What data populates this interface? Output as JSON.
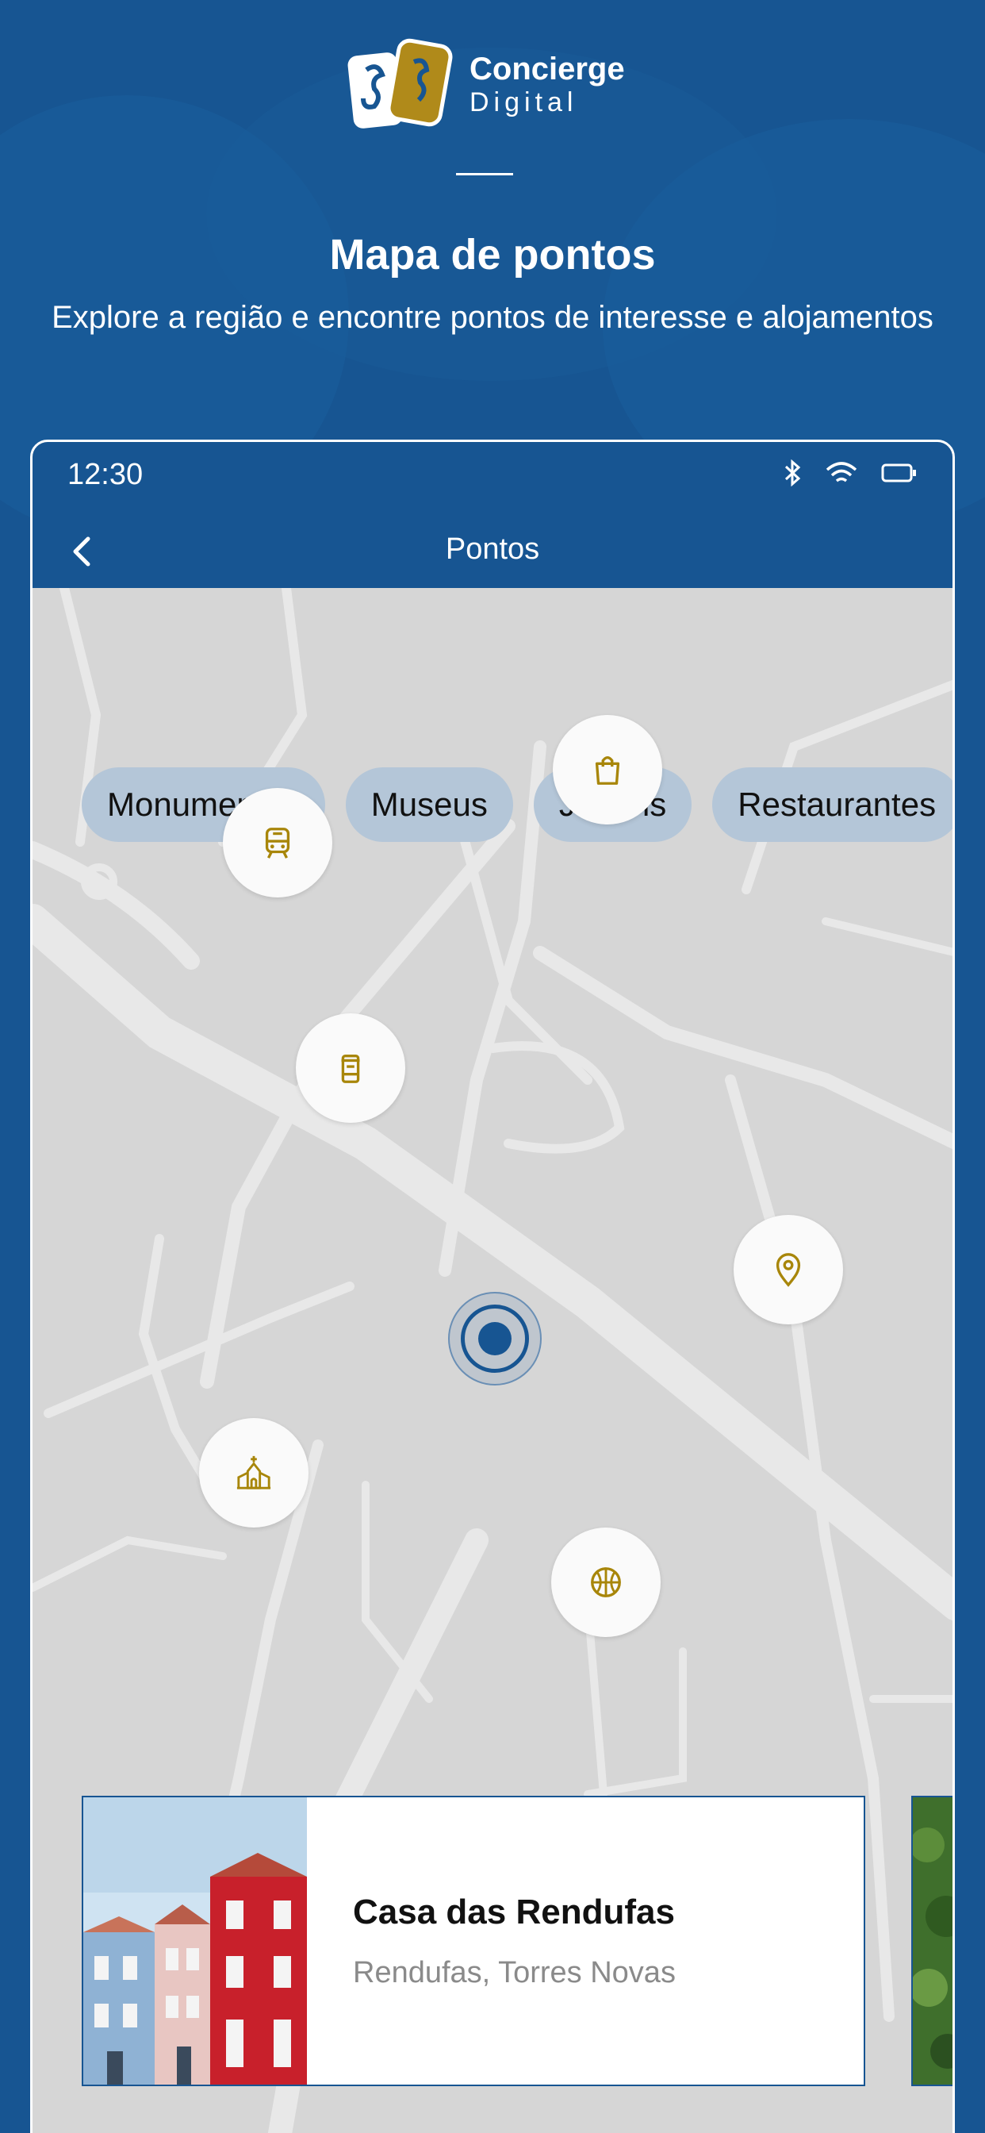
{
  "brand": {
    "title": "Concierge",
    "subtitle": "Digital"
  },
  "header": {
    "title": "Mapa de pontos",
    "subtitle": "Explore a região e encontre pontos de interesse e alojamentos"
  },
  "status": {
    "time": "12:30",
    "icons": [
      "bluetooth-icon",
      "wifi-icon",
      "battery-icon"
    ]
  },
  "appbar": {
    "title": "Pontos"
  },
  "filters": [
    "Monumentos",
    "Museus",
    "Jardins",
    "Restaurantes"
  ],
  "pins": [
    "shopping-bag-icon",
    "train-icon",
    "mailbox-icon",
    "location-pin-icon",
    "church-icon",
    "basketball-icon"
  ],
  "card": {
    "title": "Casa das Rendufas",
    "location": "Rendufas, Torres Novas"
  },
  "colors": {
    "primary": "#175592",
    "accent": "#a8860a",
    "map": "#d6d6d6",
    "chip": "#b4c6d8"
  }
}
